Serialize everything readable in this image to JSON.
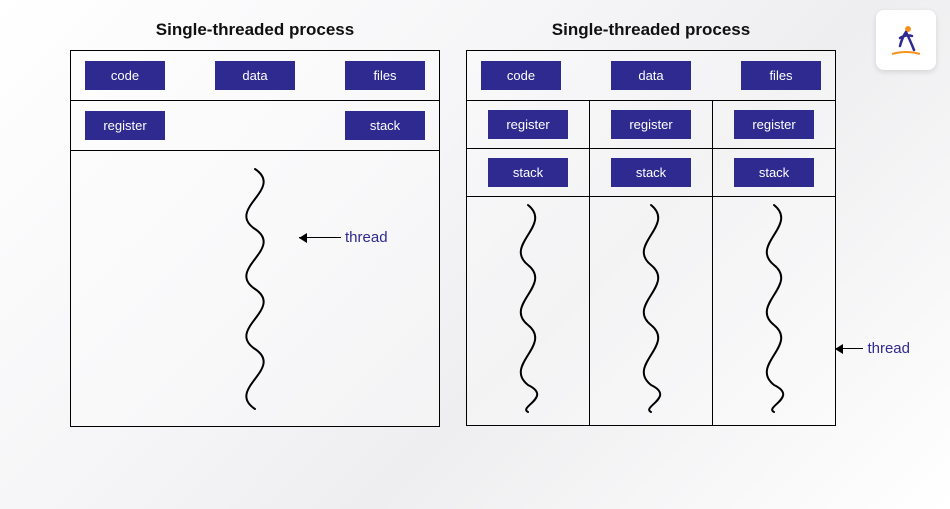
{
  "logo_alt": "brand-logo",
  "left": {
    "title": "Single-threaded process",
    "shared": [
      "code",
      "data",
      "files"
    ],
    "thread_resources": [
      "register",
      "stack"
    ],
    "annotation": "thread",
    "thread_count": 1
  },
  "right": {
    "title": "Single-threaded process",
    "shared": [
      "code",
      "data",
      "files"
    ],
    "per_thread_rows": [
      [
        "register",
        "register",
        "register"
      ],
      [
        "stack",
        "stack",
        "stack"
      ]
    ],
    "annotation": "thread",
    "thread_count": 3
  },
  "colors": {
    "chip_bg": "#2e2a8f",
    "chip_text": "#ffffff",
    "annotation_text": "#2e2a8f"
  }
}
